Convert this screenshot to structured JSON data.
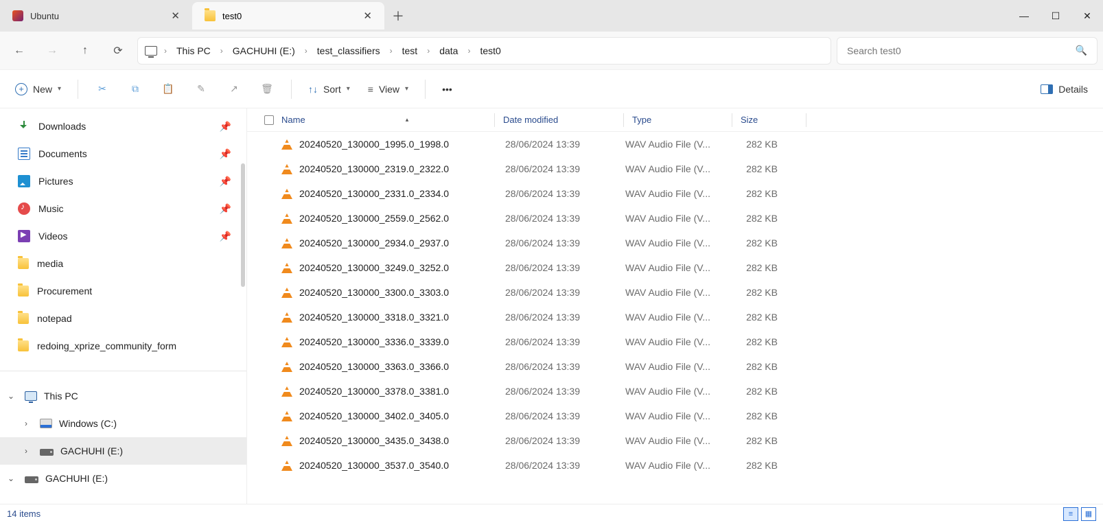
{
  "tabs": [
    {
      "label": "Ubuntu",
      "icon": "ubuntu"
    },
    {
      "label": "test0",
      "icon": "folder"
    }
  ],
  "active_tab_index": 1,
  "breadcrumbs": [
    "This PC",
    "GACHUHI (E:)",
    "test_classifiers",
    "test",
    "data",
    "test0"
  ],
  "search_placeholder": "Search test0",
  "toolbar": {
    "new_label": "New",
    "sort_label": "Sort",
    "view_label": "View",
    "details_label": "Details"
  },
  "sidebar": {
    "quick": [
      {
        "label": "Downloads",
        "icon": "dl",
        "pinned": true
      },
      {
        "label": "Documents",
        "icon": "doc",
        "pinned": true
      },
      {
        "label": "Pictures",
        "icon": "pic",
        "pinned": true
      },
      {
        "label": "Music",
        "icon": "music",
        "pinned": true
      },
      {
        "label": "Videos",
        "icon": "video",
        "pinned": true
      },
      {
        "label": "media",
        "icon": "folder",
        "pinned": false
      },
      {
        "label": "Procurement",
        "icon": "folder",
        "pinned": false
      },
      {
        "label": "notepad",
        "icon": "folder",
        "pinned": false
      },
      {
        "label": "redoing_xprize_community_form",
        "icon": "folder",
        "pinned": false
      }
    ],
    "tree": [
      {
        "label": "This PC",
        "icon": "pc",
        "expanded": true,
        "indent": 0
      },
      {
        "label": "Windows (C:)",
        "icon": "cdrive",
        "expanded": false,
        "indent": 1
      },
      {
        "label": "GACHUHI (E:)",
        "icon": "drive",
        "expanded": false,
        "indent": 1,
        "selected": true
      },
      {
        "label": "GACHUHI (E:)",
        "icon": "drive",
        "expanded": true,
        "indent": 0
      }
    ]
  },
  "columns": {
    "name": "Name",
    "date": "Date modified",
    "type": "Type",
    "size": "Size"
  },
  "files": [
    {
      "name": "20240520_130000_1995.0_1998.0",
      "date": "28/06/2024 13:39",
      "type": "WAV Audio File (V...",
      "size": "282 KB"
    },
    {
      "name": "20240520_130000_2319.0_2322.0",
      "date": "28/06/2024 13:39",
      "type": "WAV Audio File (V...",
      "size": "282 KB"
    },
    {
      "name": "20240520_130000_2331.0_2334.0",
      "date": "28/06/2024 13:39",
      "type": "WAV Audio File (V...",
      "size": "282 KB"
    },
    {
      "name": "20240520_130000_2559.0_2562.0",
      "date": "28/06/2024 13:39",
      "type": "WAV Audio File (V...",
      "size": "282 KB"
    },
    {
      "name": "20240520_130000_2934.0_2937.0",
      "date": "28/06/2024 13:39",
      "type": "WAV Audio File (V...",
      "size": "282 KB"
    },
    {
      "name": "20240520_130000_3249.0_3252.0",
      "date": "28/06/2024 13:39",
      "type": "WAV Audio File (V...",
      "size": "282 KB"
    },
    {
      "name": "20240520_130000_3300.0_3303.0",
      "date": "28/06/2024 13:39",
      "type": "WAV Audio File (V...",
      "size": "282 KB"
    },
    {
      "name": "20240520_130000_3318.0_3321.0",
      "date": "28/06/2024 13:39",
      "type": "WAV Audio File (V...",
      "size": "282 KB"
    },
    {
      "name": "20240520_130000_3336.0_3339.0",
      "date": "28/06/2024 13:39",
      "type": "WAV Audio File (V...",
      "size": "282 KB"
    },
    {
      "name": "20240520_130000_3363.0_3366.0",
      "date": "28/06/2024 13:39",
      "type": "WAV Audio File (V...",
      "size": "282 KB"
    },
    {
      "name": "20240520_130000_3378.0_3381.0",
      "date": "28/06/2024 13:39",
      "type": "WAV Audio File (V...",
      "size": "282 KB"
    },
    {
      "name": "20240520_130000_3402.0_3405.0",
      "date": "28/06/2024 13:39",
      "type": "WAV Audio File (V...",
      "size": "282 KB"
    },
    {
      "name": "20240520_130000_3435.0_3438.0",
      "date": "28/06/2024 13:39",
      "type": "WAV Audio File (V...",
      "size": "282 KB"
    },
    {
      "name": "20240520_130000_3537.0_3540.0",
      "date": "28/06/2024 13:39",
      "type": "WAV Audio File (V...",
      "size": "282 KB"
    }
  ],
  "status_text": "14 items"
}
